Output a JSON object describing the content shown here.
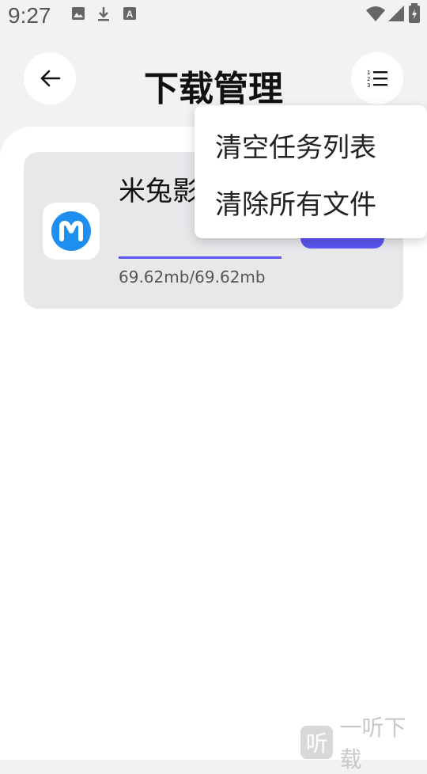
{
  "status_bar": {
    "time": "9:27",
    "left_icons": [
      "image-icon",
      "download-icon",
      "font-icon"
    ],
    "right_icons": [
      "wifi-icon",
      "signal-icon",
      "battery-icon"
    ]
  },
  "header": {
    "title": "下载管理",
    "back_icon": "arrow-left-icon",
    "menu_icon": "numbered-list-icon"
  },
  "download_item": {
    "file_name": "米兔影视.apk",
    "size": "69.62mb/69.62mb",
    "progress": 1.0,
    "accent_color": "#5a55f0"
  },
  "menu": {
    "items": [
      {
        "label": "清空任务列表"
      },
      {
        "label": "清除所有文件"
      }
    ]
  },
  "watermark": {
    "logo_text": "听",
    "text": "一听下载"
  }
}
